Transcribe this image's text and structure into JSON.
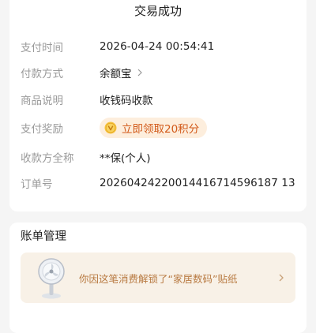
{
  "header": {
    "title": "交易成功"
  },
  "details": [
    {
      "label": "支付时间",
      "value": "2026-04-24 00:54:41"
    },
    {
      "label": "付款方式",
      "value": "余额宝"
    },
    {
      "label": "商品说明",
      "value": "收钱码收款"
    },
    {
      "label": "支付奖励",
      "value": "立即领取20积分"
    },
    {
      "label": "收款方全称",
      "value": "**保(个人)"
    },
    {
      "label": "订单号",
      "value": "20260424220014416714596187 13"
    }
  ],
  "bill": {
    "title": "账单管理",
    "sticker_text": "你因这笔消费解锁了“家居数码”贴纸"
  },
  "icons": {
    "reward": "coin-v-icon",
    "payment_chevron": "chevron-right-icon",
    "sticker": "desk-fan-icon",
    "banner_chevron": "chevron-right-icon"
  },
  "colors": {
    "reward_text": "#d25a1a",
    "reward_bg": "#fdeedd",
    "banner_bg": "#f8f1e7",
    "banner_text": "#b87a42"
  }
}
